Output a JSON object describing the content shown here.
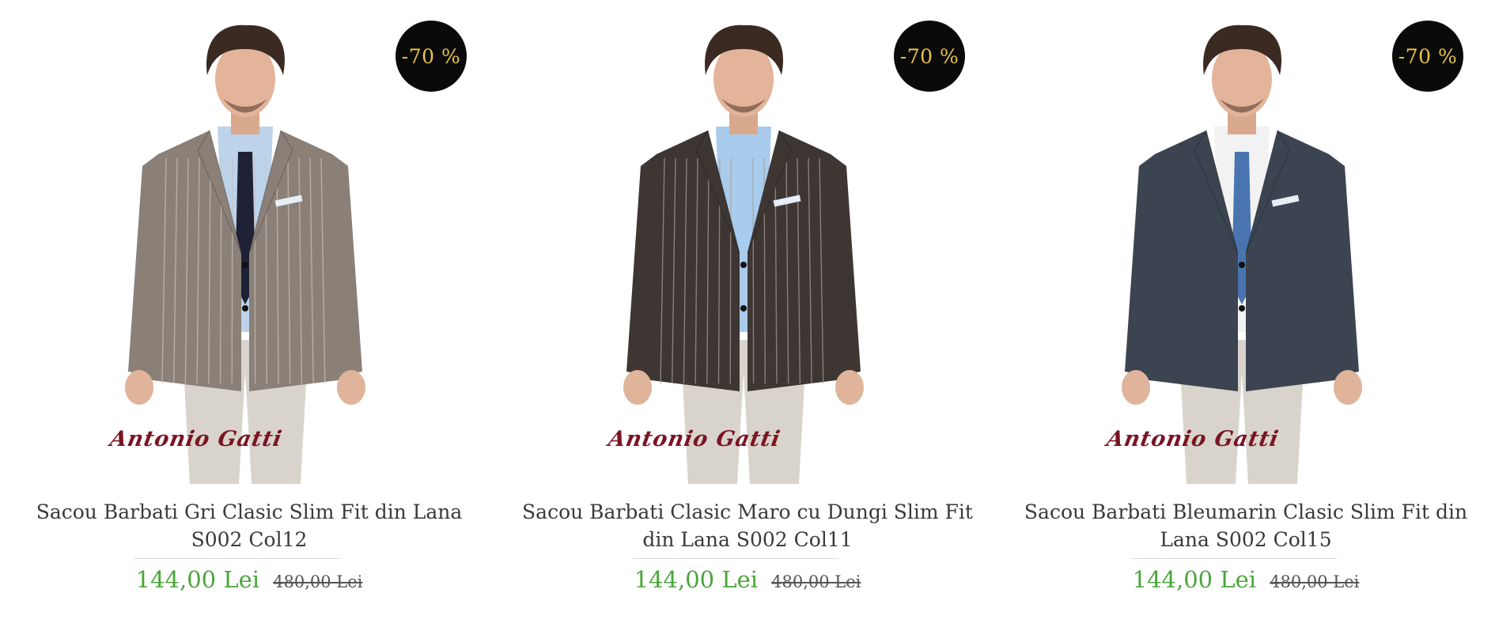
{
  "products": [
    {
      "discount": "-70 %",
      "brand": "Antonio Gatti",
      "title": "Sacou Barbati Gri Clasic Slim Fit din Lana S002 Col12",
      "price": "144,00 Lei",
      "old_price": "480,00 Lei",
      "jacket_color": "#8a8078",
      "stripe_color": "#c9c2bb",
      "tie_color": "#1f2236",
      "shirt_color": "#bcd3ea"
    },
    {
      "discount": "-70 %",
      "brand": "Antonio Gatti",
      "title": "Sacou Barbati Clasic Maro cu Dungi Slim Fit din Lana S002 Col11",
      "price": "144,00 Lei",
      "old_price": "480,00 Lei",
      "jacket_color": "#3d3633",
      "stripe_color": "#a89e98",
      "tie_color": "none",
      "shirt_color": "#a9cbec"
    },
    {
      "discount": "-70 %",
      "brand": "Antonio Gatti",
      "title": "Sacou Barbati Bleumarin Clasic Slim Fit din Lana S002 Col15",
      "price": "144,00 Lei",
      "old_price": "480,00 Lei",
      "jacket_color": "#3b4450",
      "stripe_color": "none",
      "tie_color": "#4a74b0",
      "shirt_color": "#f2f2f2"
    }
  ]
}
